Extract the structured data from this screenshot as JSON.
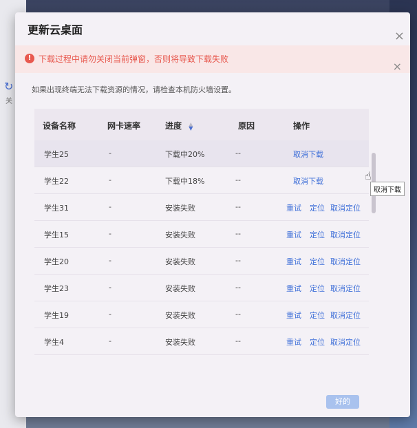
{
  "dialog": {
    "title": "更新云桌面",
    "close_icon": "×"
  },
  "alert": {
    "icon": "!",
    "text": "下载过程中请勿关闭当前弹窗，否则将导致下载失败",
    "close_icon": "×",
    "color": "#e8594f"
  },
  "hint": "如果出现终端无法下载资源的情况，请检查本机防火墙设置。",
  "table": {
    "columns": [
      "设备名称",
      "网卡速率",
      "进度",
      "原因",
      "操作"
    ],
    "rows": [
      {
        "name": "学生25",
        "speed": "-",
        "progress": "下载中20%",
        "reason": "--",
        "ops": [
          "取消下载"
        ]
      },
      {
        "name": "学生22",
        "speed": "-",
        "progress": "下载中18%",
        "reason": "--",
        "ops": [
          "取消下载"
        ]
      },
      {
        "name": "学生31",
        "speed": "-",
        "progress": "安装失败",
        "reason": "--",
        "ops": [
          "重试",
          "定位",
          "取消定位"
        ]
      },
      {
        "name": "学生15",
        "speed": "-",
        "progress": "安装失败",
        "reason": "--",
        "ops": [
          "重试",
          "定位",
          "取消定位"
        ]
      },
      {
        "name": "学生20",
        "speed": "-",
        "progress": "安装失败",
        "reason": "--",
        "ops": [
          "重试",
          "定位",
          "取消定位"
        ]
      },
      {
        "name": "学生23",
        "speed": "-",
        "progress": "安装失败",
        "reason": "--",
        "ops": [
          "重试",
          "定位",
          "取消定位"
        ]
      },
      {
        "name": "学生19",
        "speed": "-",
        "progress": "安装失败",
        "reason": "--",
        "ops": [
          "重试",
          "定位",
          "取消定位"
        ]
      },
      {
        "name": "学生4",
        "speed": "-",
        "progress": "安装失败",
        "reason": "--",
        "ops": [
          "重试",
          "定位",
          "取消定位"
        ]
      }
    ]
  },
  "tooltip": "取消下载",
  "footer": {
    "ok_label": "好的"
  },
  "background": {
    "side_label": "关"
  },
  "colors": {
    "link": "#3e6fd8",
    "primary_disabled": "#a9c2ee"
  }
}
